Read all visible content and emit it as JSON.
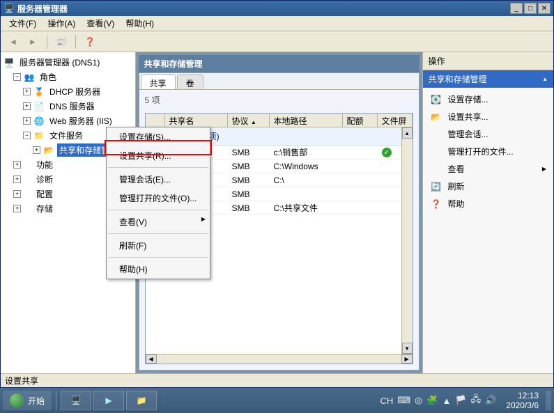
{
  "window": {
    "title": "服务器管理器"
  },
  "menu": {
    "file": "文件(F)",
    "action": "操作(A)",
    "view": "查看(V)",
    "help": "帮助(H)"
  },
  "tree": {
    "root": "服务器管理器 (DNS1)",
    "roles": "角色",
    "dhcp": "DHCP 服务器",
    "dns": "DNS 服务器",
    "web": "Web 服务器 (IIS)",
    "fileserv": "文件服务",
    "share_storage": "共享和存储管理",
    "features": "功能",
    "diag": "诊断",
    "config": "配置",
    "storage": "存储"
  },
  "center": {
    "title": "共享和存储管理",
    "tabs": {
      "share": "共享",
      "volume": "卷"
    },
    "count": "5 项",
    "cols": {
      "name": "共享名",
      "proto": "协议",
      "path": "本地路径",
      "quota": "配额",
      "filter": "文件屏"
    },
    "group": "(5 项)",
    "rows": [
      {
        "name": "",
        "proto": "SMB",
        "path": "c:\\销售部",
        "check": true
      },
      {
        "name": "",
        "proto": "SMB",
        "path": "C:\\Windows",
        "check": false
      },
      {
        "name": "",
        "proto": "SMB",
        "path": "C:\\",
        "check": false
      },
      {
        "name": "",
        "proto": "SMB",
        "path": "",
        "check": false
      },
      {
        "name": "",
        "proto": "SMB",
        "path": "C:\\共享文件",
        "check": false
      }
    ]
  },
  "ctx": {
    "set_storage": "设置存储(S)...",
    "set_share": "设置共享(R)...",
    "sessions": "管理会话(E)...",
    "open_files": "管理打开的文件(O)...",
    "view": "查看(V)",
    "refresh": "刷新(F)",
    "help": "帮助(H)"
  },
  "actions": {
    "header": "操作",
    "title": "共享和存储管理",
    "items": {
      "set_storage": "设置存储...",
      "set_share": "设置共享...",
      "sessions": "管理会话...",
      "open_files": "管理打开的文件...",
      "view": "查看",
      "refresh": "刷新",
      "help": "帮助"
    }
  },
  "status": "设置共享",
  "taskbar": {
    "start": "开始",
    "lang": "CH",
    "time": "12:13",
    "date": "2020/3/6"
  }
}
